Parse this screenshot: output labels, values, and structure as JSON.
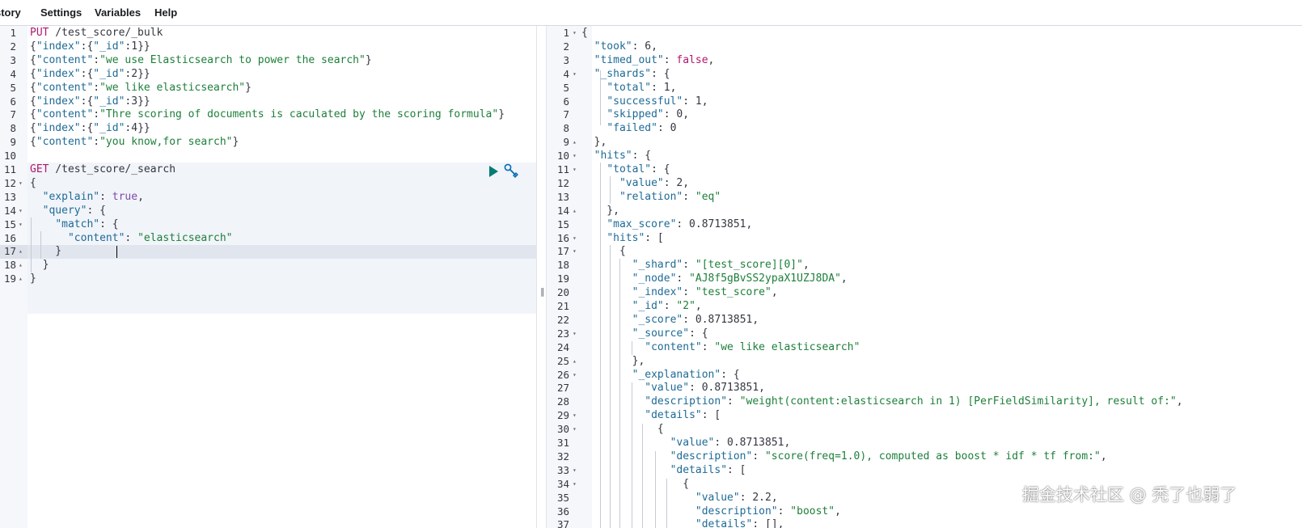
{
  "menu": {
    "history": "story",
    "settings": "Settings",
    "variables": "Variables",
    "help": "Help"
  },
  "request_editor": {
    "lines": [
      [
        [
          "m",
          "PUT"
        ],
        [
          "p",
          " /test_score/_bulk"
        ]
      ],
      [
        [
          "p",
          "{"
        ],
        [
          "k",
          "\"index\""
        ],
        [
          "p",
          ":{"
        ],
        [
          "k",
          "\"_id\""
        ],
        [
          "p",
          ":1}}"
        ]
      ],
      [
        [
          "p",
          "{"
        ],
        [
          "k",
          "\"content\""
        ],
        [
          "p",
          ":"
        ],
        [
          "s",
          "\"we use Elasticsearch to power the search\""
        ],
        [
          "p",
          "}"
        ]
      ],
      [
        [
          "p",
          "{"
        ],
        [
          "k",
          "\"index\""
        ],
        [
          "p",
          ":{"
        ],
        [
          "k",
          "\"_id\""
        ],
        [
          "p",
          ":2}}"
        ]
      ],
      [
        [
          "p",
          "{"
        ],
        [
          "k",
          "\"content\""
        ],
        [
          "p",
          ":"
        ],
        [
          "s",
          "\"we like elasticsearch\""
        ],
        [
          "p",
          "}"
        ]
      ],
      [
        [
          "p",
          "{"
        ],
        [
          "k",
          "\"index\""
        ],
        [
          "p",
          ":{"
        ],
        [
          "k",
          "\"_id\""
        ],
        [
          "p",
          ":3}}"
        ]
      ],
      [
        [
          "p",
          "{"
        ],
        [
          "k",
          "\"content\""
        ],
        [
          "p",
          ":"
        ],
        [
          "s",
          "\"Thre scoring of documents is caculated by the scoring formula\""
        ],
        [
          "p",
          "}"
        ]
      ],
      [
        [
          "p",
          "{"
        ],
        [
          "k",
          "\"index\""
        ],
        [
          "p",
          ":{"
        ],
        [
          "k",
          "\"_id\""
        ],
        [
          "p",
          ":4}}"
        ]
      ],
      [
        [
          "p",
          "{"
        ],
        [
          "k",
          "\"content\""
        ],
        [
          "p",
          ":"
        ],
        [
          "s",
          "\"you know,for search\""
        ],
        [
          "p",
          "}"
        ]
      ],
      [
        [
          "p",
          ""
        ]
      ],
      [
        [
          "m",
          "GET"
        ],
        [
          "p",
          " /test_score/_search"
        ]
      ],
      [
        [
          "p",
          "{"
        ]
      ],
      [
        [
          "p",
          "  "
        ],
        [
          "k",
          "\"explain\""
        ],
        [
          "p",
          ": "
        ],
        [
          "b",
          "true"
        ],
        [
          "p",
          ","
        ]
      ],
      [
        [
          "p",
          "  "
        ],
        [
          "k",
          "\"query\""
        ],
        [
          "p",
          ": {"
        ]
      ],
      [
        [
          "p",
          "    "
        ],
        [
          "k",
          "\"match\""
        ],
        [
          "p",
          ": {"
        ]
      ],
      [
        [
          "p",
          "      "
        ],
        [
          "k",
          "\"content\""
        ],
        [
          "p",
          ": "
        ],
        [
          "s",
          "\"elasticsearch\""
        ]
      ],
      [
        [
          "p",
          "    }"
        ]
      ],
      [
        [
          "p",
          "  }"
        ]
      ],
      [
        [
          "p",
          "}"
        ]
      ]
    ],
    "fold_lines": {
      "12": "▾",
      "14": "▾",
      "15": "▾",
      "17": "▴",
      "18": "▴",
      "19": "▴"
    }
  },
  "response_viewer": {
    "lines": [
      [
        [
          "p",
          "{"
        ]
      ],
      [
        [
          "p",
          "  "
        ],
        [
          "k",
          "\"took\""
        ],
        [
          "p",
          ": 6,"
        ]
      ],
      [
        [
          "p",
          "  "
        ],
        [
          "k",
          "\"timed_out\""
        ],
        [
          "p",
          ": "
        ],
        [
          "m",
          "false"
        ],
        [
          "p",
          ","
        ]
      ],
      [
        [
          "p",
          "  "
        ],
        [
          "k",
          "\"_shards\""
        ],
        [
          "p",
          ": {"
        ]
      ],
      [
        [
          "p",
          "    "
        ],
        [
          "k",
          "\"total\""
        ],
        [
          "p",
          ": 1,"
        ]
      ],
      [
        [
          "p",
          "    "
        ],
        [
          "k",
          "\"successful\""
        ],
        [
          "p",
          ": 1,"
        ]
      ],
      [
        [
          "p",
          "    "
        ],
        [
          "k",
          "\"skipped\""
        ],
        [
          "p",
          ": 0,"
        ]
      ],
      [
        [
          "p",
          "    "
        ],
        [
          "k",
          "\"failed\""
        ],
        [
          "p",
          ": 0"
        ]
      ],
      [
        [
          "p",
          "  },"
        ]
      ],
      [
        [
          "p",
          "  "
        ],
        [
          "k",
          "\"hits\""
        ],
        [
          "p",
          ": {"
        ]
      ],
      [
        [
          "p",
          "    "
        ],
        [
          "k",
          "\"total\""
        ],
        [
          "p",
          ": {"
        ]
      ],
      [
        [
          "p",
          "      "
        ],
        [
          "k",
          "\"value\""
        ],
        [
          "p",
          ": 2,"
        ]
      ],
      [
        [
          "p",
          "      "
        ],
        [
          "k",
          "\"relation\""
        ],
        [
          "p",
          ": "
        ],
        [
          "s",
          "\"eq\""
        ]
      ],
      [
        [
          "p",
          "    },"
        ]
      ],
      [
        [
          "p",
          "    "
        ],
        [
          "k",
          "\"max_score\""
        ],
        [
          "p",
          ": 0.8713851,"
        ]
      ],
      [
        [
          "p",
          "    "
        ],
        [
          "k",
          "\"hits\""
        ],
        [
          "p",
          ": ["
        ]
      ],
      [
        [
          "p",
          "      {"
        ]
      ],
      [
        [
          "p",
          "        "
        ],
        [
          "k",
          "\"_shard\""
        ],
        [
          "p",
          ": "
        ],
        [
          "s",
          "\"[test_score][0]\""
        ],
        [
          "p",
          ","
        ]
      ],
      [
        [
          "p",
          "        "
        ],
        [
          "k",
          "\"_node\""
        ],
        [
          "p",
          ": "
        ],
        [
          "s",
          "\"AJ8f5gBvSS2ypaX1UZJ8DA\""
        ],
        [
          "p",
          ","
        ]
      ],
      [
        [
          "p",
          "        "
        ],
        [
          "k",
          "\"_index\""
        ],
        [
          "p",
          ": "
        ],
        [
          "s",
          "\"test_score\""
        ],
        [
          "p",
          ","
        ]
      ],
      [
        [
          "p",
          "        "
        ],
        [
          "k",
          "\"_id\""
        ],
        [
          "p",
          ": "
        ],
        [
          "s",
          "\"2\""
        ],
        [
          "p",
          ","
        ]
      ],
      [
        [
          "p",
          "        "
        ],
        [
          "k",
          "\"_score\""
        ],
        [
          "p",
          ": 0.8713851,"
        ]
      ],
      [
        [
          "p",
          "        "
        ],
        [
          "k",
          "\"_source\""
        ],
        [
          "p",
          ": {"
        ]
      ],
      [
        [
          "p",
          "          "
        ],
        [
          "k",
          "\"content\""
        ],
        [
          "p",
          ": "
        ],
        [
          "s",
          "\"we like elasticsearch\""
        ]
      ],
      [
        [
          "p",
          "        },"
        ]
      ],
      [
        [
          "p",
          "        "
        ],
        [
          "k",
          "\"_explanation\""
        ],
        [
          "p",
          ": {"
        ]
      ],
      [
        [
          "p",
          "          "
        ],
        [
          "k",
          "\"value\""
        ],
        [
          "p",
          ": 0.8713851,"
        ]
      ],
      [
        [
          "p",
          "          "
        ],
        [
          "k",
          "\"description\""
        ],
        [
          "p",
          ": "
        ],
        [
          "s",
          "\"weight(content:elasticsearch in 1) [PerFieldSimilarity], result of:\""
        ],
        [
          "p",
          ","
        ]
      ],
      [
        [
          "p",
          "          "
        ],
        [
          "k",
          "\"details\""
        ],
        [
          "p",
          ": ["
        ]
      ],
      [
        [
          "p",
          "            {"
        ]
      ],
      [
        [
          "p",
          "              "
        ],
        [
          "k",
          "\"value\""
        ],
        [
          "p",
          ": 0.8713851,"
        ]
      ],
      [
        [
          "p",
          "              "
        ],
        [
          "k",
          "\"description\""
        ],
        [
          "p",
          ": "
        ],
        [
          "s",
          "\"score(freq=1.0), computed as boost * idf * tf from:\""
        ],
        [
          "p",
          ","
        ]
      ],
      [
        [
          "p",
          "              "
        ],
        [
          "k",
          "\"details\""
        ],
        [
          "p",
          ": ["
        ]
      ],
      [
        [
          "p",
          "                {"
        ]
      ],
      [
        [
          "p",
          "                  "
        ],
        [
          "k",
          "\"value\""
        ],
        [
          "p",
          ": 2.2,"
        ]
      ],
      [
        [
          "p",
          "                  "
        ],
        [
          "k",
          "\"description\""
        ],
        [
          "p",
          ": "
        ],
        [
          "s",
          "\"boost\""
        ],
        [
          "p",
          ","
        ]
      ],
      [
        [
          "p",
          "                  "
        ],
        [
          "k",
          "\"details\""
        ],
        [
          "p",
          ": [],"
        ]
      ]
    ],
    "fold_lines": {
      "1": "▾",
      "4": "▾",
      "9": "▴",
      "10": "▾",
      "11": "▾",
      "14": "▴",
      "16": "▾",
      "17": "▾",
      "23": "▾",
      "25": "▴",
      "26": "▾",
      "29": "▾",
      "30": "▾",
      "33": "▾",
      "34": "▾"
    }
  },
  "watermark": "掘金技术社区 @ 秃了也弱了",
  "colors": {
    "key": "#1e6a96",
    "string": "#1d7f3a",
    "method": "#b0176f",
    "boolean": "#7c4aa6",
    "run": "#017d73"
  },
  "icons": {
    "run": "play-icon",
    "settings": "wrench-icon",
    "resize": "resize-grip-icon"
  }
}
